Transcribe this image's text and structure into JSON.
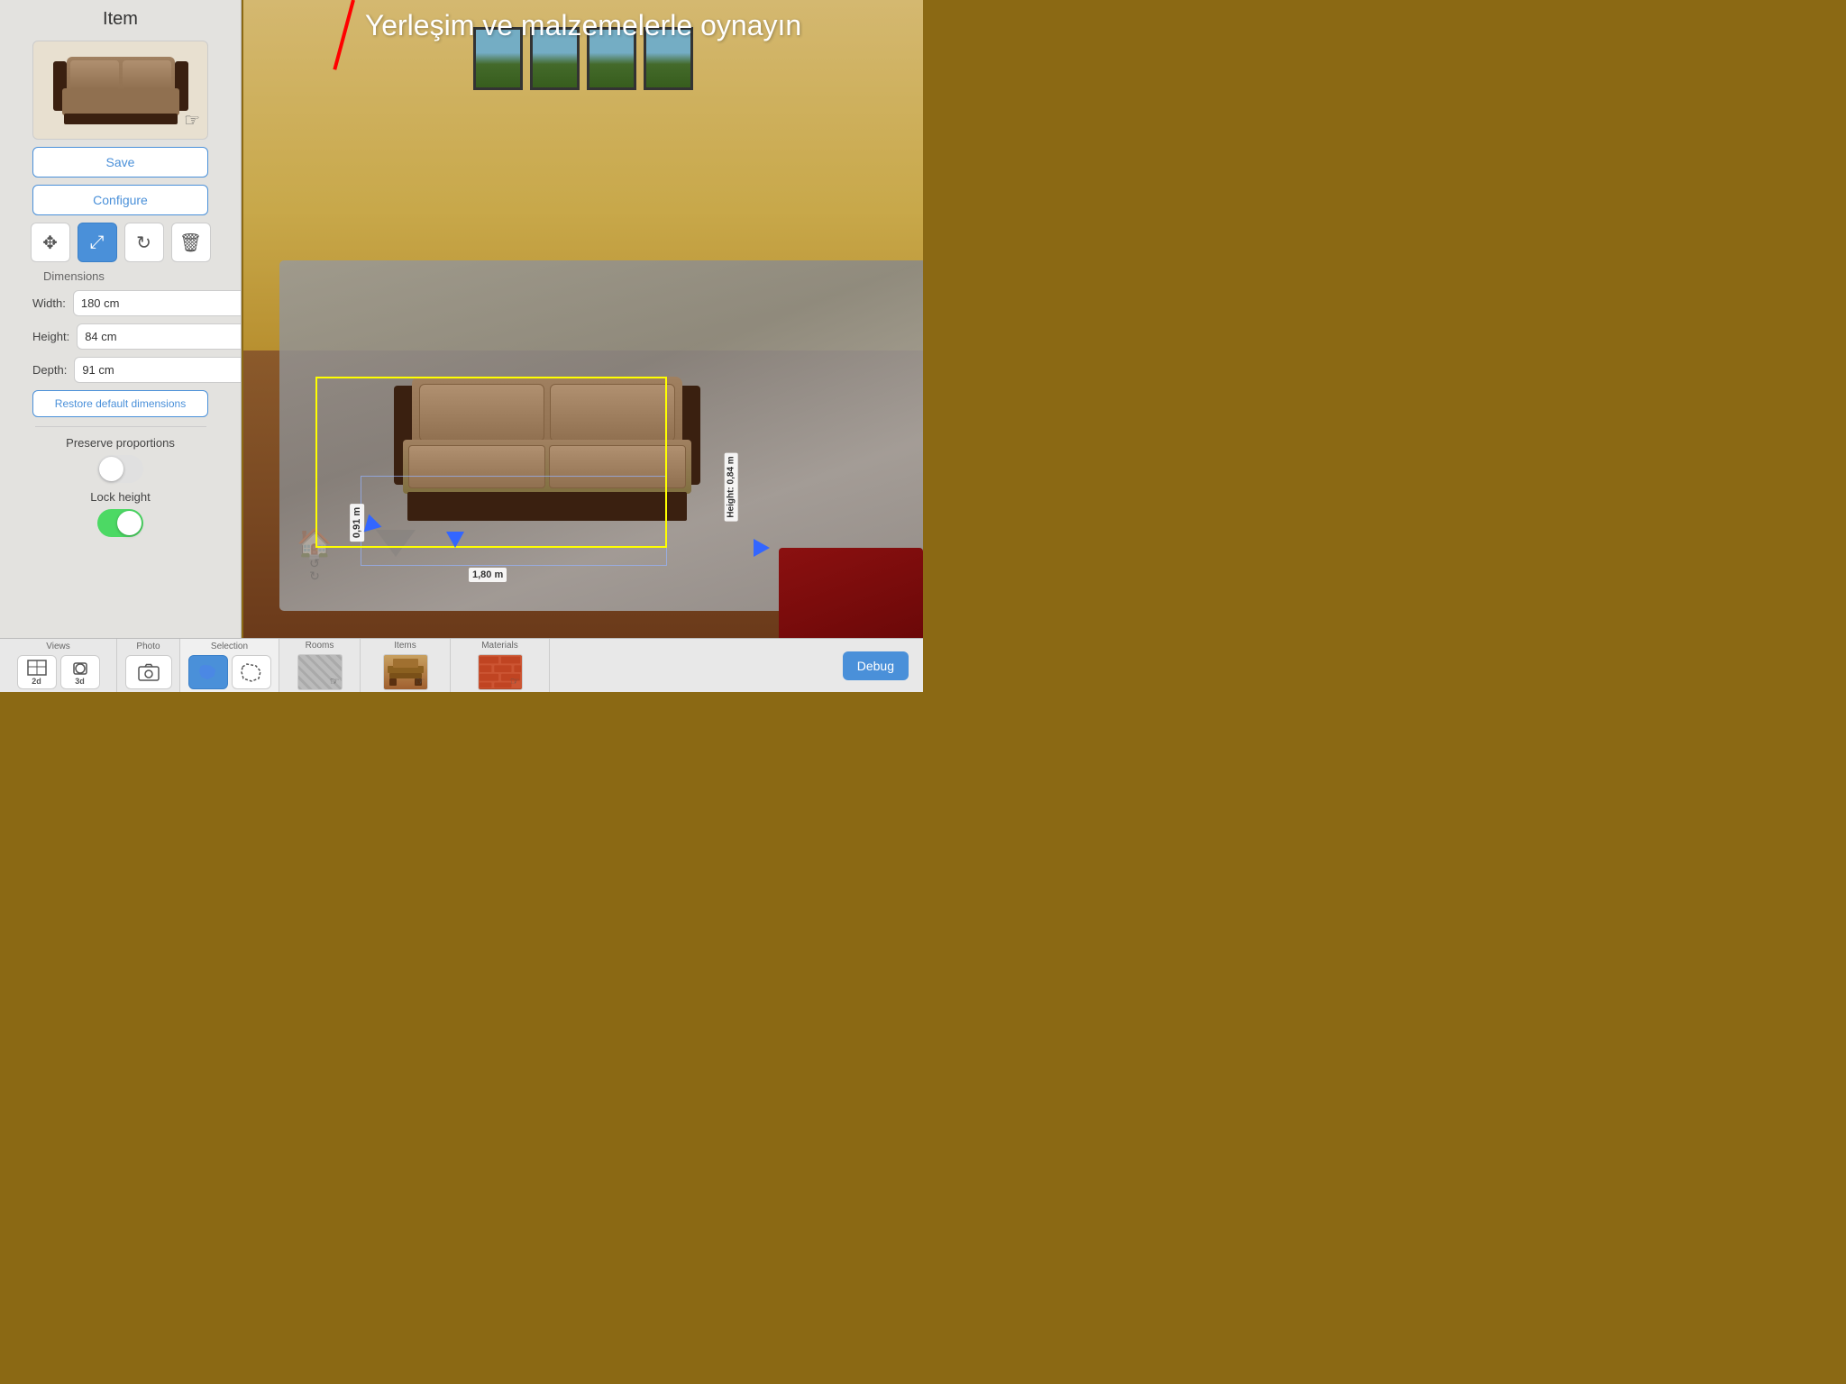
{
  "panel": {
    "title": "Item",
    "save_label": "Save",
    "configure_label": "Configure",
    "dimensions_label": "Dimensions",
    "width_label": "Width:",
    "width_value": "180 cm",
    "height_label": "Height:",
    "height_value": "84 cm",
    "depth_label": "Depth:",
    "depth_value": "91 cm",
    "restore_label": "Restore default dimensions",
    "preserve_label": "Preserve proportions",
    "lock_label": "Lock height"
  },
  "scene": {
    "title": "Yerleşim ve malzemelerle oynayın",
    "dim_width": "1,80 m",
    "dim_depth": "0,91 m",
    "dim_height": "Height: 0,84 m"
  },
  "bottom": {
    "views_label": "Views",
    "photo_label": "Photo",
    "selection_label": "Selection",
    "rooms_label": "Rooms",
    "items_label": "Items",
    "materials_label": "Materials",
    "debug_label": "Debug",
    "view_2d": "2d",
    "view_3d": "3d"
  },
  "tools": {
    "move": "✥",
    "scale": "⤢",
    "rotate": "↻",
    "delete": "🗑"
  }
}
